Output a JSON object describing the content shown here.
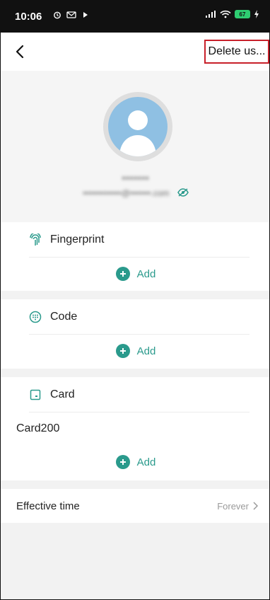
{
  "status_bar": {
    "time": "10:06",
    "battery": "67"
  },
  "nav": {
    "delete_label": "Delete us..."
  },
  "profile": {
    "name": "•••••••",
    "email": "•••••••••••••@•••••••.com"
  },
  "sections": {
    "fingerprint": {
      "label": "Fingerprint",
      "add_label": "Add"
    },
    "code": {
      "label": "Code",
      "add_label": "Add"
    },
    "card": {
      "label": "Card",
      "item": "Card200",
      "add_label": "Add"
    }
  },
  "effective_time": {
    "label": "Effective time",
    "value": "Forever"
  },
  "colors": {
    "accent": "#2a9a8c",
    "highlight_border": "#c8202a",
    "avatar": "#8fc0e3"
  }
}
